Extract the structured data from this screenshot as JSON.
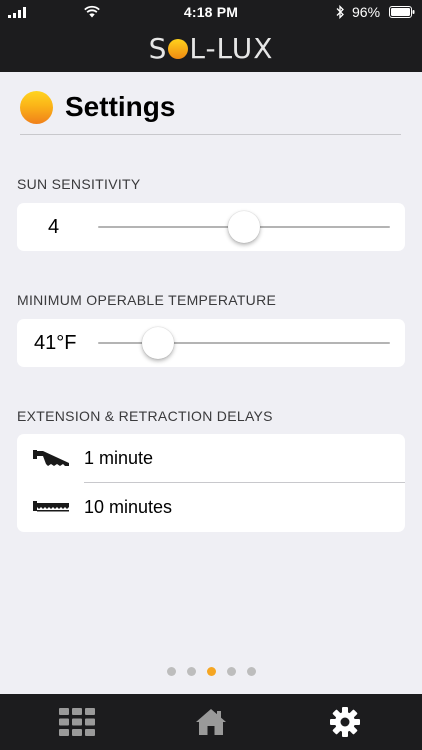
{
  "status_bar": {
    "time": "4:18 PM",
    "battery_percent": "96%",
    "icons": [
      "signal-icon",
      "wifi-icon",
      "bluetooth-icon",
      "battery-icon"
    ]
  },
  "header": {
    "brand_left": "S",
    "brand_right": "L-LUX"
  },
  "page": {
    "title": "Settings",
    "icon": "sun-icon"
  },
  "sections": {
    "sun_sensitivity": {
      "label": "SUN SENSITIVITY",
      "value": "4",
      "slider_level": 0.5
    },
    "min_temp": {
      "label": "MINIMUM OPERABLE TEMPERATURE",
      "value": "41°F",
      "slider_level": 0.17
    },
    "delays": {
      "label": "EXTENSION & RETRACTION DELAYS",
      "extension": {
        "icon": "awning-extended-icon",
        "value": "1 minute"
      },
      "retraction": {
        "icon": "awning-retracted-icon",
        "value": "10 minutes"
      }
    }
  },
  "pager": {
    "count": 5,
    "active_index": 2
  },
  "tab_bar": {
    "tabs": [
      {
        "icon": "grid-icon",
        "active": false
      },
      {
        "icon": "home-icon",
        "active": false
      },
      {
        "icon": "gear-icon",
        "active": true
      }
    ]
  },
  "colors": {
    "accent": "#f5a623",
    "background": "#efeff4",
    "chrome": "#1c1c1e",
    "inactive_icon": "#9a9a9a"
  }
}
